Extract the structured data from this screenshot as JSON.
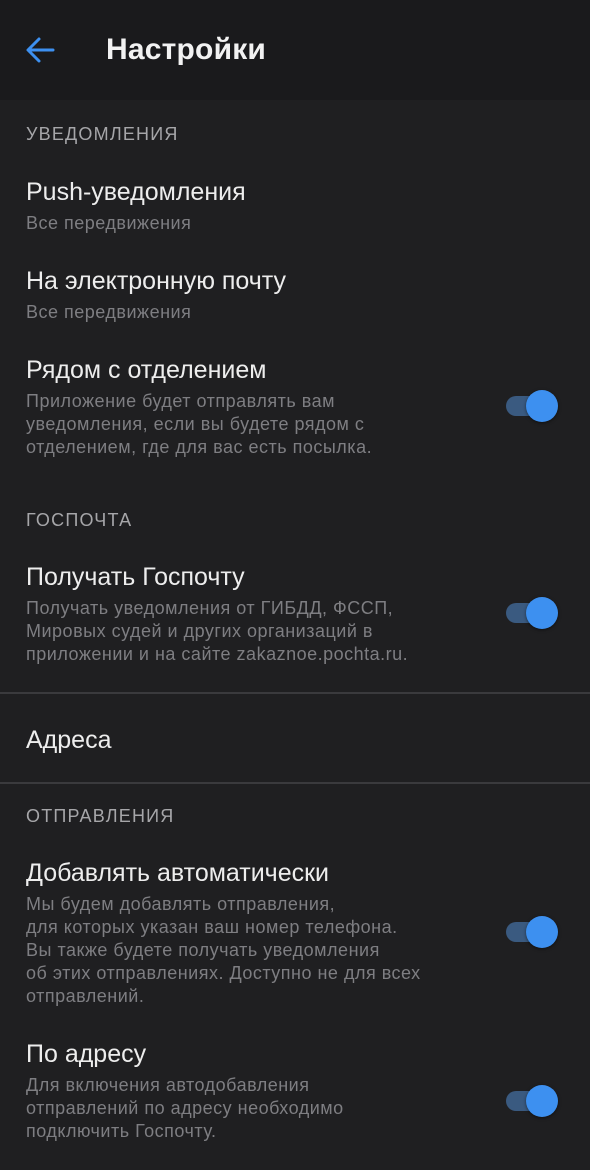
{
  "header": {
    "title": "Настройки",
    "back_icon": "arrow-left-icon",
    "accent_color": "#3d90f0"
  },
  "sections": {
    "notifications": {
      "label": "УВЕДОМЛЕНИЯ",
      "push": {
        "title": "Push-уведомления",
        "value": "Все передвижения"
      },
      "email": {
        "title": "На электронную почту",
        "value": "Все передвижения"
      },
      "nearby": {
        "title": "Рядом с отделением",
        "description": "Приложение будет отправлять вам\nуведомления, если вы будете рядом с\nотделением, где для вас есть посылка.",
        "enabled": true
      }
    },
    "gospochta": {
      "label": "ГОСПОЧТА",
      "receive": {
        "title": "Получать Госпочту",
        "description": "Получать уведомления от ГИБДД, ФССП,\nМировых судей и других организаций в\nприложении и на сайте zakaznoe.pochta.ru.",
        "enabled": true
      }
    },
    "addresses": {
      "title": "Адреса"
    },
    "shipments": {
      "label": "ОТПРАВЛЕНИЯ",
      "auto_add": {
        "title": "Добавлять автоматически",
        "description": "Мы будем добавлять отправления,\nдля которых указан ваш номер телефона.\nВы также будете получать уведомления\nоб этих отправлениях. Доступно не для всех\nотправлений.",
        "enabled": true
      },
      "by_address": {
        "title": "По адресу",
        "description": "Для включения автодобавления\nотправлений по адресу необходимо\nподключить Госпочту.",
        "enabled": true
      }
    }
  }
}
